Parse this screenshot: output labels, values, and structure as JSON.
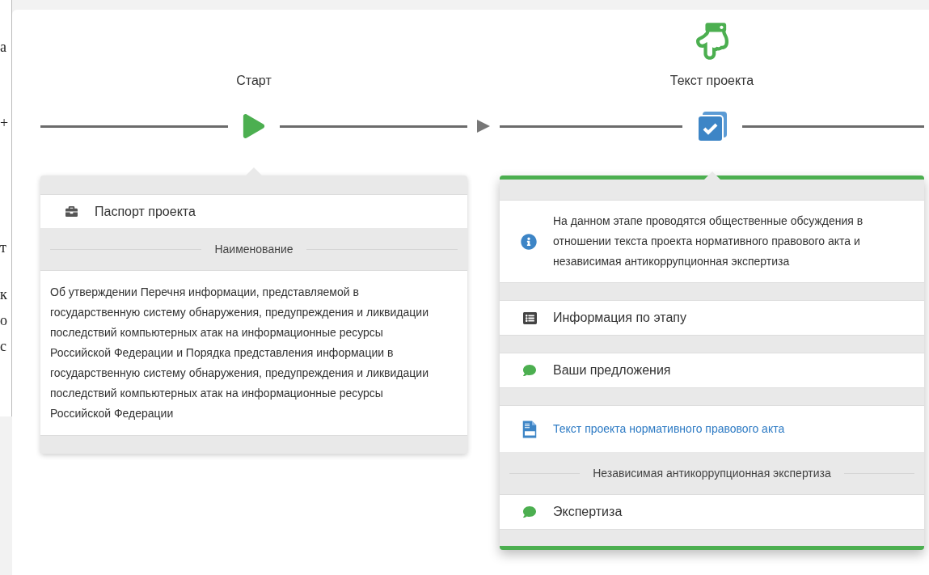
{
  "background_window": {
    "fragments": [
      "а",
      "+",
      "т",
      "к",
      "о",
      "с"
    ]
  },
  "stages": [
    {
      "label": "Старт",
      "kind": "start",
      "selected": false
    },
    {
      "label": "Текст проекта",
      "kind": "text",
      "selected": true
    }
  ],
  "passport": {
    "title": "Паспорт проекта",
    "section": "Наименование",
    "body": "Об утверждении Перечня информации, представляемой в государственную систему обнаружения, предупреждения и ликвидации последствий компьютерных атак на информационные ресурсы Российской Федерации и Порядка представления информации в государственную систему обнаружения, предупреждения и ликвидации последствий компьютерных атак на информационные ресурсы Российской Федерации"
  },
  "stage_card": {
    "info": "На данном этапе проводятся общественные обсуждения в отношении текста проекта нормативного правового акта и независимая антикоррупционная экспертиза",
    "rows": [
      {
        "kind": "list",
        "label": "Информация по этапу"
      },
      {
        "kind": "comment",
        "label": "Ваши предложения"
      },
      {
        "kind": "document",
        "label": "Текст проекта нормативного правового акта"
      },
      {
        "kind": "section",
        "label": "Независимая антикоррупционная экспертиза"
      },
      {
        "kind": "comment",
        "label": "Экспертиза"
      }
    ]
  }
}
